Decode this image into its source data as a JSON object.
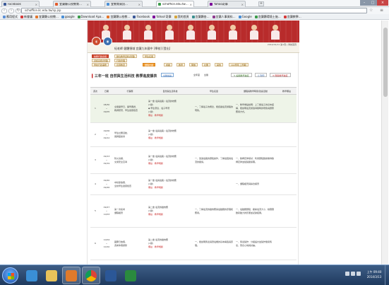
{
  "browser": {
    "tabs": [
      {
        "label": "Facebook",
        "color": "#3b5998",
        "active": false
      },
      {
        "label": "宜蘭縣公校教育…",
        "color": "#e35b2b",
        "active": false
      },
      {
        "label": "宜教育資訊…",
        "color": "#4a8fd6",
        "active": false
      },
      {
        "label": "schoffice.edu.tw…",
        "color": "#3a9c4a",
        "active": true
      },
      {
        "label": "Yahoo奇摩",
        "color": "#7b0099",
        "active": false
      }
    ],
    "url": "schoffice.ilc.edu.tw/sp.jsp",
    "bookmarks": [
      {
        "label": "應用程式",
        "color": "#5a8fd6"
      },
      {
        "label": "新會議",
        "color": "#d63a3a"
      },
      {
        "label": "宜蘭縣公校教…",
        "color": "#e3762b"
      },
      {
        "label": "google",
        "color": "#4a8fd6"
      },
      {
        "label": "Download Apa…",
        "color": "#3a9c4a"
      },
      {
        "label": "宜蘭縣公校教…",
        "color": "#e3762b"
      },
      {
        "label": "Facebook",
        "color": "#3b5998"
      },
      {
        "label": "Yahoo!奇摩",
        "color": "#7b0099"
      },
      {
        "label": "我的首頁",
        "color": "#d6a63a"
      },
      {
        "label": "宜蘭縣各…",
        "color": "#3a8f8f"
      },
      {
        "label": "宜蘭人事資料…",
        "color": "#8f3a8f"
      },
      {
        "label": "Google",
        "color": "#4a8fd6"
      },
      {
        "label": "宜蘭縣環境士施…",
        "color": "#3a9c4a"
      },
      {
        "label": "宜蘭教學…",
        "color": "#d63a3a"
      }
    ]
  },
  "site": {
    "banner_alt": "",
    "profile": {
      "text": "紀老師 健體領域 宜蘭九年國中 [學校] [登出]",
      "date": "2014/01/11 第1頁 | 導航首頁",
      "avatar1": "老",
      "avatar2": "學"
    },
    "subtabs": [
      {
        "label": "校務行政系統",
        "style": "red"
      },
      {
        "label": "資訊系統(管理)",
        "style": "plain"
      },
      {
        "label": "學校行政事務",
        "style": "plain"
      },
      {
        "label": "數位教學資料(管理)",
        "style": "plain"
      },
      {
        "label": "行政管理",
        "style": "plain"
      },
      {
        "label": "資源教室",
        "style": "plain"
      },
      {
        "label": "課程計畫",
        "style": "hl"
      },
      {
        "label": "學生名冊",
        "style": "plain"
      },
      {
        "label": "成績",
        "style": "plain"
      },
      {
        "label": "教學",
        "style": "plain"
      },
      {
        "label": "問卷",
        "style": "plain"
      },
      {
        "label": "社團",
        "style": "plain"
      },
      {
        "label": "其他",
        "style": "plain"
      },
      {
        "label": "102學年 上學期",
        "style": "plain"
      }
    ],
    "page_title": "三年一班 自然與生活科技 教學進度課表",
    "title_tags": [
      "全數加議",
      "全年度",
      "全體"
    ],
    "buttons": {
      "edit": "編輯教學進度",
      "print": "列印",
      "delete": "刪除教學進度"
    },
    "table": {
      "headers": [
        "週次",
        "日期",
        "行事曆",
        "自然與生活科技",
        "學生名單",
        "課程與教學時間/建議活動",
        "教學備註"
      ],
      "rows": [
        {
          "week": "1",
          "date": "08/30\n~\n09/05",
          "events": "全體開學日、開學典禮、\n教師研習、學生健康檢查",
          "unit": "第一章 電與電路 / 電流的效應\n(1節)\n◆ 學生發表、電子學習\n(1節)",
          "tag": "備註 · 教學規劃",
          "students": "一、了解電子的概念，能認識電流通路的現象。",
          "activities": "一、教學重點說明：上了解電子的基本結構、能說明電流通過導體時的現象與實際應用方式。"
        },
        {
          "week": "2",
          "date": "09/06\n~\n09/12",
          "events": "學生社團活動、\n親師座談會",
          "unit": "第一章 電與電路 / 電流的效應\n(1節)",
          "tag": "備註 · 教學規劃",
          "students": "",
          "activities": ""
        },
        {
          "week": "3",
          "date": "09/13\n~\n09/19",
          "events": "防災演練、\n交通安全宣導",
          "unit": "第一章 電與電路 / 電流的效應\n(1節)",
          "tag": "備註 · 教學規劃",
          "students": "一、透過電路的實驗操作，了解電阻與電流的關係。",
          "activities": "一、歐姆定律探討：利用實驗數據推導歐姆定律並繪製關係圖。"
        },
        {
          "week": "4",
          "date": "09/20\n~\n09/26",
          "events": "中秋節放假、\n全校學生健康檢查",
          "unit": "第一章 電與電路 / 電流的效應\n(1節)",
          "tag": "備註 · 教學規劃",
          "students": "",
          "activities": "一、課程複習與綜合練習"
        },
        {
          "week": "5",
          "date": "09/27\n~\n10/03",
          "events": "第一次段考\n課程複習",
          "unit": "第二章 電流的磁效應\n(1節)",
          "tag": "備註 · 教學規劃",
          "students": "一、了解電流的磁效應與電磁鐵的原理和應用。",
          "activities": "一、電磁鐵實驗：觀察電流大小、線圈圈數對磁力的影響並記錄結果。"
        },
        {
          "week": "6",
          "date": "10/04\n~\n10/10",
          "events": "國慶日放假、\n週末休假調整",
          "unit": "第二章 電流的磁效應\n(1節)",
          "tag": "備註 · 教學規劃",
          "students": "一、能說明馬達與發電機的基本構造與原理。",
          "activities": "一、馬達製作：分組設計並製作簡易馬達，發表心得與討論。"
        }
      ]
    }
  },
  "taskbar": {
    "apps": [
      {
        "name": "ie",
        "color": "#3a8fd6"
      },
      {
        "name": "explorer",
        "color": "#e8c25a"
      },
      {
        "name": "media",
        "color": "#e07a2b"
      },
      {
        "name": "chrome",
        "color": "#4fae4a"
      },
      {
        "name": "word",
        "color": "#2b5797"
      },
      {
        "name": "excel",
        "color": "#2a8a3e"
      }
    ],
    "time": "上午 09:40",
    "date": "2014/3/13"
  },
  "colors": {
    "banner": "#b82b2b",
    "accent_red": "#c92a2a",
    "accent_blue": "#2a5ea8"
  }
}
